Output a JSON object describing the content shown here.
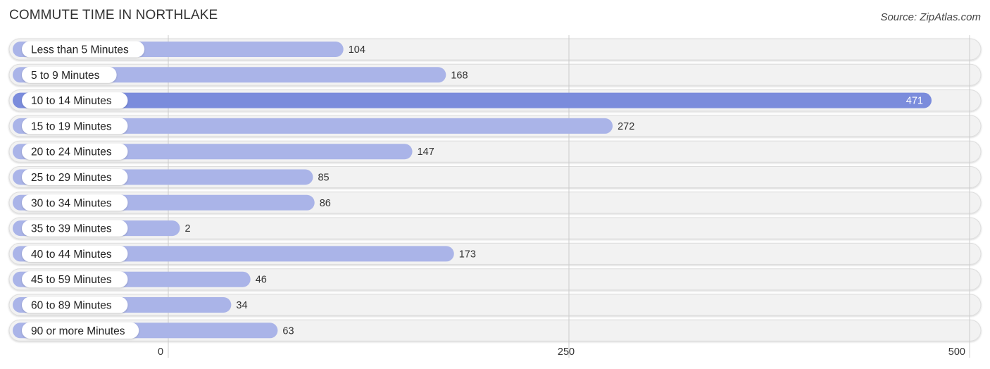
{
  "header": {
    "title": "COMMUTE TIME IN NORTHLAKE",
    "source": "Source: ZipAtlas.com"
  },
  "colors": {
    "bar": "#aab4e8",
    "bar_highlight": "#7b8cdc",
    "track": "#f2f2f2",
    "track_border": "#dddddd",
    "grid": "#cccccc"
  },
  "chart_data": {
    "type": "bar",
    "orientation": "horizontal",
    "title": "COMMUTE TIME IN NORTHLAKE",
    "categories": [
      "Less than 5 Minutes",
      "5 to 9 Minutes",
      "10 to 14 Minutes",
      "15 to 19 Minutes",
      "20 to 24 Minutes",
      "25 to 29 Minutes",
      "30 to 34 Minutes",
      "35 to 39 Minutes",
      "40 to 44 Minutes",
      "45 to 59 Minutes",
      "60 to 89 Minutes",
      "90 or more Minutes"
    ],
    "values": [
      104,
      168,
      471,
      272,
      147,
      85,
      86,
      2,
      173,
      46,
      34,
      63
    ],
    "highlight_index": 2,
    "xlabel": "",
    "ylabel": "",
    "xlim": [
      0,
      500
    ],
    "xticks": [
      0,
      250,
      500
    ],
    "xtick_labels": [
      "0",
      "250",
      "500"
    ],
    "grid": true,
    "legend": "none"
  }
}
